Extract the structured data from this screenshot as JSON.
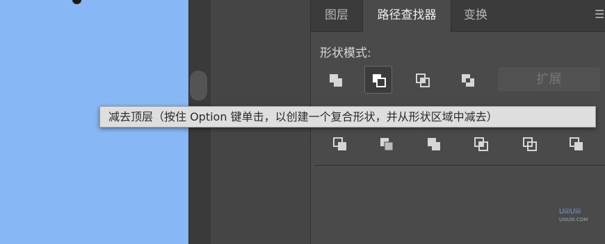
{
  "panel": {
    "tabs": [
      {
        "label": "图层",
        "active": false
      },
      {
        "label": "路径查找器",
        "active": true
      },
      {
        "label": "变换",
        "active": false
      }
    ],
    "menu_icon": "hamburger-menu-icon",
    "shape_modes_label": "形状模式:",
    "shape_mode_buttons": [
      "unite-icon",
      "minus-front-icon",
      "intersect-icon",
      "exclude-icon"
    ],
    "expand_label": "扩展",
    "pathfinder_buttons": [
      "divide-icon",
      "trim-icon",
      "merge-icon",
      "crop-icon",
      "outline-icon",
      "minus-back-icon"
    ]
  },
  "tooltip": {
    "text": "减去顶层（按住 Option 键单击，以创建一个复合形状，并从形状区域中减去）"
  },
  "watermark": {
    "top": "UiiiUiii",
    "bottom": "UIIIUIII.COM"
  },
  "colors": {
    "canvas": "#87b8f5",
    "panel": "#4a4a4a",
    "tooltip": "#dedede"
  }
}
